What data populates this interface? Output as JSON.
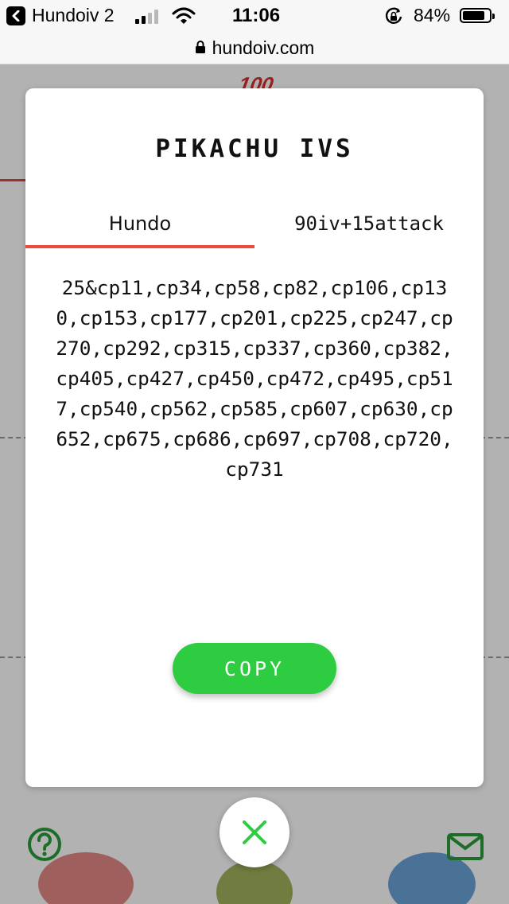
{
  "status_bar": {
    "back_app": "Hundoiv 2",
    "time": "11:06",
    "battery_percent": "84%",
    "battery_level": 0.84
  },
  "address_bar": {
    "url": "hundoiv.com"
  },
  "background": {
    "hundred_badge": "100"
  },
  "modal": {
    "title": "PIKACHU IVS",
    "tabs": [
      {
        "label": "Hundo",
        "selected": true
      },
      {
        "label": "90iv+15attack",
        "selected": false
      }
    ],
    "search_string": "25&cp11,cp34,cp58,cp82,cp106,cp130,cp153,cp177,cp201,cp225,cp247,cp270,cp292,cp315,cp337,cp360,cp382,cp405,cp427,cp450,cp472,cp495,cp517,cp540,cp562,cp585,cp607,cp630,cp652,cp675,cp686,cp697,cp708,cp720,cp731",
    "copy_label": "COPY"
  },
  "icons": {
    "back": "back-arrow-icon",
    "signal": "cellular-signal-icon",
    "wifi": "wifi-icon",
    "rotation_lock": "rotation-lock-icon",
    "battery": "battery-icon",
    "padlock": "padlock-icon",
    "close": "close-x-icon",
    "help": "question-mark-icon",
    "mail": "mail-icon"
  },
  "colors": {
    "accent_red": "#ea4c3f",
    "copy_green": "#2ecc40",
    "close_green": "#2ecc40",
    "help_green": "#2a9d3a"
  }
}
